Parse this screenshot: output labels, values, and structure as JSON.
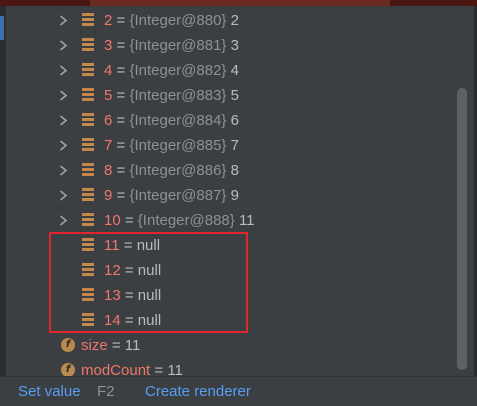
{
  "debugger_variables": {
    "expandable_rows": [
      {
        "index": "2",
        "equals": "=",
        "ref": "{Integer@880}",
        "value": "2"
      },
      {
        "index": "3",
        "equals": "=",
        "ref": "{Integer@881}",
        "value": "3"
      },
      {
        "index": "4",
        "equals": "=",
        "ref": "{Integer@882}",
        "value": "4"
      },
      {
        "index": "5",
        "equals": "=",
        "ref": "{Integer@883}",
        "value": "5"
      },
      {
        "index": "6",
        "equals": "=",
        "ref": "{Integer@884}",
        "value": "6"
      },
      {
        "index": "7",
        "equals": "=",
        "ref": "{Integer@885}",
        "value": "7"
      },
      {
        "index": "8",
        "equals": "=",
        "ref": "{Integer@886}",
        "value": "8"
      },
      {
        "index": "9",
        "equals": "=",
        "ref": "{Integer@887}",
        "value": "9"
      },
      {
        "index": "10",
        "equals": "=",
        "ref": "{Integer@888}",
        "value": "11"
      }
    ],
    "null_rows": [
      {
        "index": "11",
        "equals": "=",
        "value": "null"
      },
      {
        "index": "12",
        "equals": "=",
        "value": "null"
      },
      {
        "index": "13",
        "equals": "=",
        "value": "null"
      },
      {
        "index": "14",
        "equals": "=",
        "value": "null"
      }
    ],
    "fields": [
      {
        "icon_letter": "f",
        "name": "size",
        "equals": "=",
        "value": "11"
      },
      {
        "icon_letter": "f",
        "name": "modCount",
        "equals": "=",
        "value": "11"
      }
    ]
  },
  "bottom_bar": {
    "set_value_label": "Set value",
    "set_value_shortcut": "F2",
    "create_renderer_label": "Create renderer"
  },
  "colors": {
    "index": "#f0766d",
    "reference": "#8e9194",
    "text": "#bbbbbb",
    "link": "#589df6",
    "highlight_border": "#e2242d",
    "array_icon": "#c5874a",
    "background": "#3c3f41"
  }
}
